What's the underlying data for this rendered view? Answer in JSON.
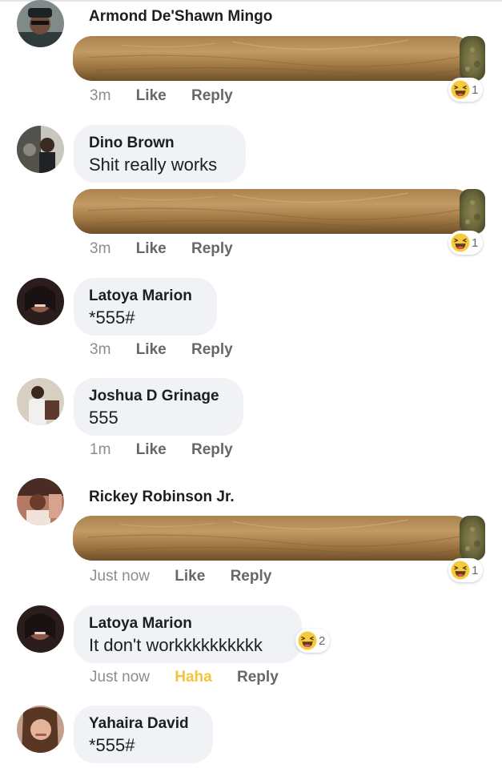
{
  "comments": [
    {
      "name": "Armond De'Shawn Mingo",
      "time": "3m",
      "like": "Like",
      "reply": "Reply",
      "reaction_count": "1"
    },
    {
      "name": "Dino Brown",
      "text": "Shit really works",
      "time": "3m",
      "like": "Like",
      "reply": "Reply",
      "reaction_count": "1"
    },
    {
      "name": "Latoya Marion",
      "text": "*555#",
      "time": "3m",
      "like": "Like",
      "reply": "Reply"
    },
    {
      "name": "Joshua D Grinage",
      "text": "555",
      "time": "1m",
      "like": "Like",
      "reply": "Reply"
    },
    {
      "name": "Rickey Robinson Jr.",
      "time": "Just now",
      "like": "Like",
      "reply": "Reply",
      "reaction_count": "1"
    },
    {
      "name": "Latoya Marion",
      "text": "It don't workkkkkkkkkk",
      "time": "Just now",
      "like": "Haha",
      "reply": "Reply",
      "reaction_count": "2"
    },
    {
      "name": "Yahaira David",
      "text": "*555#"
    }
  ],
  "icons": {
    "reaction": "haha-emoji-icon",
    "sticker": "cigar-sticker"
  },
  "colors": {
    "bubble": "#f0f2f5",
    "haha": "#f5c33b",
    "meta": "#65676b"
  }
}
